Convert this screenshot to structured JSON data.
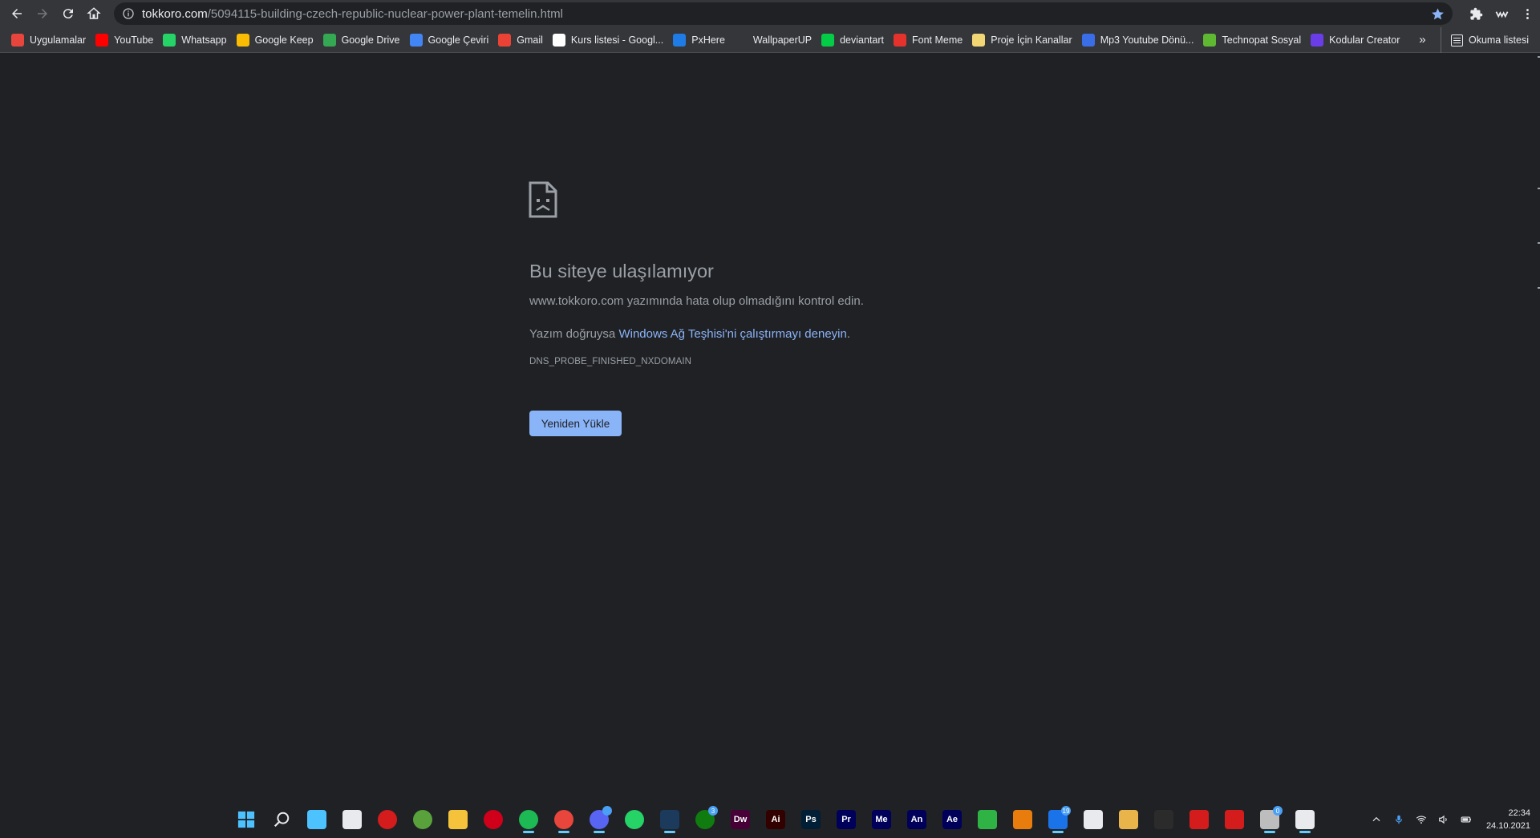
{
  "browser": {
    "url_host": "tokkoro.com",
    "url_path": "/5094115-building-czech-republic-nuclear-power-plant-temelin.html"
  },
  "bookmarks": [
    {
      "label": "Uygulamalar",
      "icon": "apps-grid-icon",
      "color": "#e8453c"
    },
    {
      "label": "YouTube",
      "icon": "youtube-icon",
      "color": "#ff0000"
    },
    {
      "label": "Whatsapp",
      "icon": "whatsapp-icon",
      "color": "#25d366"
    },
    {
      "label": "Google Keep",
      "icon": "google-keep-icon",
      "color": "#fbbc04"
    },
    {
      "label": "Google Drive",
      "icon": "google-drive-icon",
      "color": "#34a853"
    },
    {
      "label": "Google Çeviri",
      "icon": "google-translate-icon",
      "color": "#4285f4"
    },
    {
      "label": "Gmail",
      "icon": "gmail-icon",
      "color": "#ea4335"
    },
    {
      "label": "Kurs listesi - Googl...",
      "icon": "google-icon",
      "color": "#ffffff"
    },
    {
      "label": "PxHere",
      "icon": "pxhere-icon",
      "color": "#1f7ce6"
    },
    {
      "label": "WallpaperUP",
      "icon": "wallpaperup-icon",
      "color": "#35363a"
    },
    {
      "label": "deviantart",
      "icon": "deviantart-icon",
      "color": "#05cc47"
    },
    {
      "label": "Font Meme",
      "icon": "fontmeme-icon",
      "color": "#e5322d"
    },
    {
      "label": "Proje İçin Kanallar",
      "icon": "folder-icon",
      "color": "#f2d675"
    },
    {
      "label": "Mp3 Youtube Dönü...",
      "icon": "mp3-icon",
      "color": "#3a6ee8"
    },
    {
      "label": "Technopat Sosyal",
      "icon": "technopat-icon",
      "color": "#5fb832"
    },
    {
      "label": "Kodular Creator",
      "icon": "kodular-icon",
      "color": "#6a3de8"
    }
  ],
  "bookmarks_more": "»",
  "reading_list": "Okuma listesi",
  "error": {
    "title": "Bu siteye ulaşılamıyor",
    "line1": "www.tokkoro.com yazımında hata olup olmadığını kontrol edin.",
    "line2_prefix": "Yazım doğruysa ",
    "line2_link": "Windows Ağ Teşhisi'ni çalıştırmayı deneyin",
    "line2_suffix": ".",
    "code": "DNS_PROBE_FINISHED_NXDOMAIN",
    "reload_label": "Yeniden Yükle"
  },
  "taskbar": {
    "apps": [
      {
        "name": "start-icon",
        "text": "",
        "color": "#4cc2ff",
        "active": false
      },
      {
        "name": "search-icon",
        "text": "",
        "color": "#e8eaed",
        "active": false
      },
      {
        "name": "task-view-icon",
        "text": "",
        "color": "#4cc2ff",
        "active": false
      },
      {
        "name": "store-icon",
        "text": "",
        "color": "#e8eaed",
        "active": false
      },
      {
        "name": "app-red-icon",
        "text": "",
        "color": "#d41c1c",
        "active": false
      },
      {
        "name": "utorrent-icon",
        "text": "",
        "color": "#58a13b",
        "active": false
      },
      {
        "name": "file-explorer-icon",
        "text": "",
        "color": "#f5c23b",
        "active": false
      },
      {
        "name": "opera-icon",
        "text": "",
        "color": "#d0001b",
        "active": false
      },
      {
        "name": "spotify-icon",
        "text": "",
        "color": "#1db954",
        "active": true
      },
      {
        "name": "chrome-icon",
        "text": "",
        "color": "#e8453c",
        "active": true
      },
      {
        "name": "discord-icon",
        "text": "",
        "color": "#5865f2",
        "active": true,
        "badge": ""
      },
      {
        "name": "whatsapp-icon",
        "text": "",
        "color": "#25d366",
        "active": false
      },
      {
        "name": "steam-icon",
        "text": "",
        "color": "#1b3a5c",
        "active": true
      },
      {
        "name": "xbox-icon",
        "text": "",
        "color": "#107c10",
        "active": false,
        "badge": "3"
      },
      {
        "name": "dreamweaver-icon",
        "text": "Dw",
        "color": "#470137",
        "active": false
      },
      {
        "name": "illustrator-icon",
        "text": "Ai",
        "color": "#330000",
        "active": false
      },
      {
        "name": "photoshop-icon",
        "text": "Ps",
        "color": "#001e36",
        "active": false
      },
      {
        "name": "premiere-icon",
        "text": "Pr",
        "color": "#00005b",
        "active": false
      },
      {
        "name": "media-encoder-icon",
        "text": "Me",
        "color": "#00005b",
        "active": false
      },
      {
        "name": "animate-icon",
        "text": "An",
        "color": "#00005b",
        "active": false
      },
      {
        "name": "after-effects-icon",
        "text": "Ae",
        "color": "#00005b",
        "active": false
      },
      {
        "name": "camtasia-icon",
        "text": "",
        "color": "#2fb344",
        "active": false
      },
      {
        "name": "blender-icon",
        "text": "",
        "color": "#e87d0d",
        "active": false
      },
      {
        "name": "mail-icon",
        "text": "",
        "color": "#1a73e8",
        "active": true,
        "badge": "19"
      },
      {
        "name": "app-triangle-icon",
        "text": "",
        "color": "#e8eaed",
        "active": false
      },
      {
        "name": "app-figure-icon",
        "text": "",
        "color": "#e9b54a",
        "active": false
      },
      {
        "name": "app-black-icon",
        "text": "",
        "color": "#2b2b2b",
        "active": false
      },
      {
        "name": "app-red1-icon",
        "text": "",
        "color": "#d41c1c",
        "active": false
      },
      {
        "name": "app-red2-icon",
        "text": "",
        "color": "#d41c1c",
        "active": false
      },
      {
        "name": "app-grey-icon",
        "text": "",
        "color": "#bdbdbd",
        "active": true,
        "badge": "0"
      },
      {
        "name": "snipping-tool-icon",
        "text": "",
        "color": "#e8eaed",
        "active": true
      }
    ],
    "time": "22:34",
    "date": "24.10.2021"
  }
}
